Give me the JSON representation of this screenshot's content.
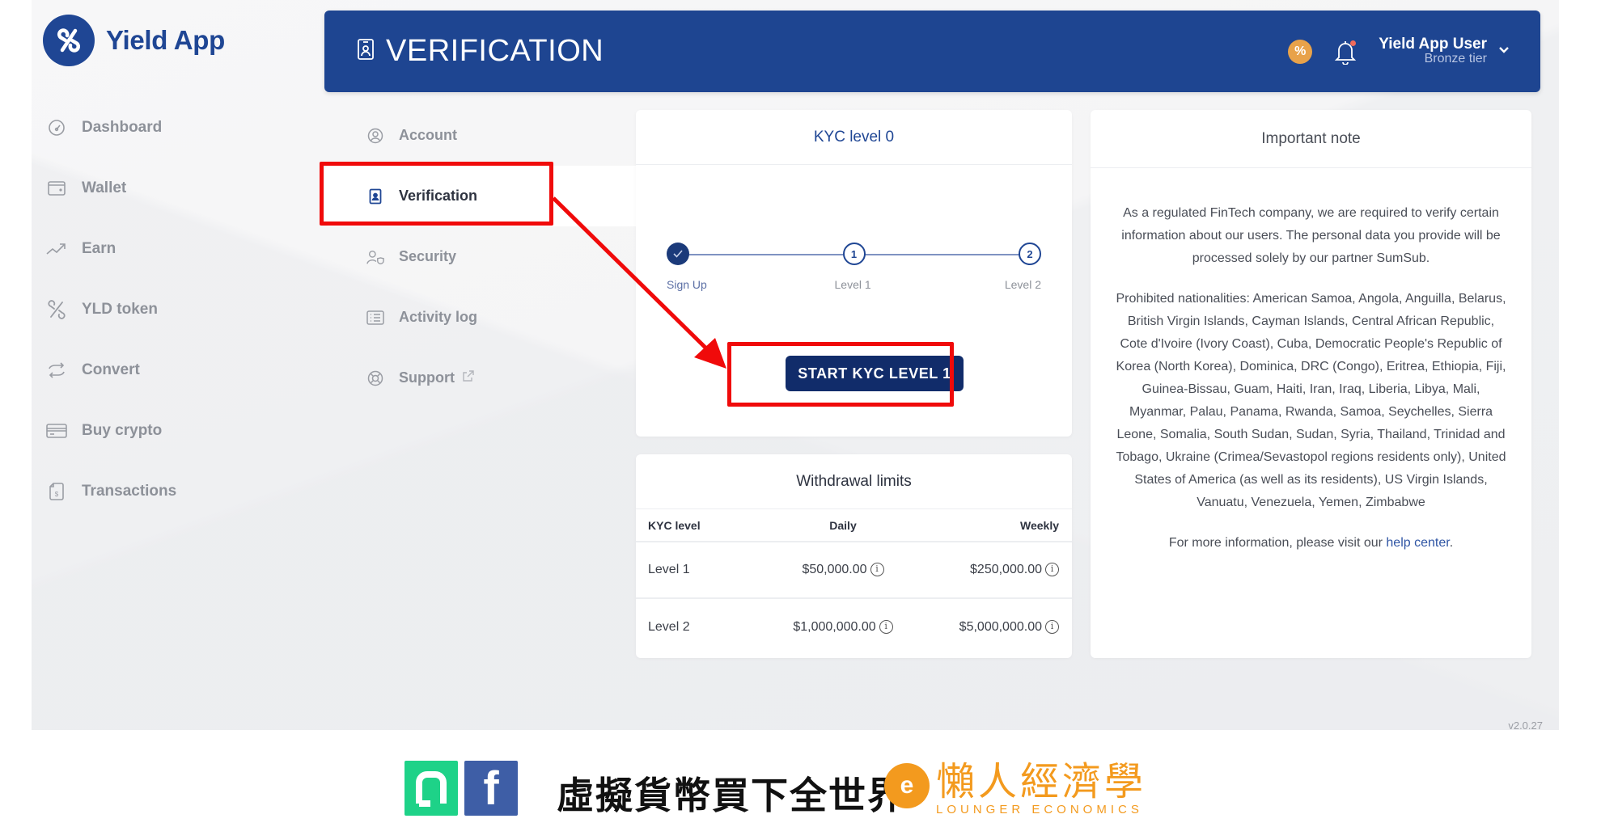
{
  "app": {
    "brand_name": "Yield App",
    "version": "v2.0.27"
  },
  "sidebar": {
    "items": [
      {
        "label": "Dashboard",
        "icon": "gauge-icon"
      },
      {
        "label": "Wallet",
        "icon": "wallet-icon"
      },
      {
        "label": "Earn",
        "icon": "trend-up-icon"
      },
      {
        "label": "YLD token",
        "icon": "yld-token-icon"
      },
      {
        "label": "Convert",
        "icon": "convert-arrows-icon"
      },
      {
        "label": "Buy crypto",
        "icon": "credit-card-icon"
      },
      {
        "label": "Transactions",
        "icon": "receipt-icon"
      }
    ]
  },
  "header": {
    "title": "VERIFICATION",
    "title_icon": "id-badge-icon",
    "promo_icon": "percent-badge-icon",
    "notifications_icon": "bell-icon",
    "user_name": "Yield App User",
    "user_tier": "Bronze tier"
  },
  "subnav": {
    "items": [
      {
        "label": "Account",
        "icon": "user-circle-icon",
        "active": false
      },
      {
        "label": "Verification",
        "icon": "id-badge-icon",
        "active": true
      },
      {
        "label": "Security",
        "icon": "user-shield-icon",
        "active": false
      },
      {
        "label": "Activity log",
        "icon": "list-icon",
        "active": false
      },
      {
        "label": "Support",
        "icon": "lifebuoy-icon",
        "active": false,
        "external": true
      }
    ]
  },
  "kyc": {
    "title": "KYC level 0",
    "steps": [
      {
        "label": "Sign Up",
        "marker": "✓",
        "status": "done"
      },
      {
        "label": "Level 1",
        "marker": "1",
        "status": "pending"
      },
      {
        "label": "Level 2",
        "marker": "2",
        "status": "pending"
      }
    ],
    "start_button": "START KYC LEVEL 1"
  },
  "withdrawal_limits": {
    "title": "Withdrawal limits",
    "columns": [
      "KYC level",
      "Daily",
      "Weekly"
    ],
    "rows": [
      {
        "level": "Level 1",
        "daily": "$50,000.00",
        "weekly": "$250,000.00"
      },
      {
        "level": "Level 2",
        "daily": "$1,000,000.00",
        "weekly": "$5,000,000.00"
      }
    ]
  },
  "important_note": {
    "title": "Important note",
    "paragraph1": "As a regulated FinTech company, we are required to verify certain information about our users. The personal data you provide will be processed solely by our partner SumSub.",
    "paragraph2": "Prohibited nationalities: American Samoa, Angola, Anguilla, Belarus, British Virgin Islands, Cayman Islands, Central African Republic, Cote d'Ivoire (Ivory Coast), Cuba, Democratic People's Republic of Korea (North Korea), Dominica, DRC (Congo), Eritrea, Ethiopia, Fiji, Guinea-Bissau, Guam, Haiti, Iran, Iraq, Liberia, Libya, Mali, Myanmar, Palau, Panama, Rwanda, Samoa, Seychelles, Sierra Leone, Somalia, South Sudan, Sudan, Syria, Thailand, Trinidad and Tobago, Ukraine (Crimea/Sevastopol regions residents only), United States of America (as well as its residents), US Virgin Islands, Vanuatu, Venezuela, Yemen, Zimbabwe",
    "footer_prefix": "For more information, please visit our ",
    "footer_link": "help center",
    "footer_suffix": "."
  },
  "annotations": {
    "color": "#f00a0a",
    "highlighted": [
      "Verification",
      "START KYC LEVEL 1"
    ]
  },
  "banner": {
    "slogan": "虛擬貨幣買下全世界",
    "brand_cn": "懶人經濟學",
    "brand_en": "LOUNGER ECONOMICS",
    "brand_mark": "e",
    "fb_glyph": "f"
  },
  "colors": {
    "brand_blue": "#1e4591",
    "button_navy": "#112c6a",
    "promo_orange": "#e8a24a",
    "banner_orange": "#f39a1e",
    "banner_green": "#1ed288",
    "facebook_blue": "#3e5ea6"
  }
}
